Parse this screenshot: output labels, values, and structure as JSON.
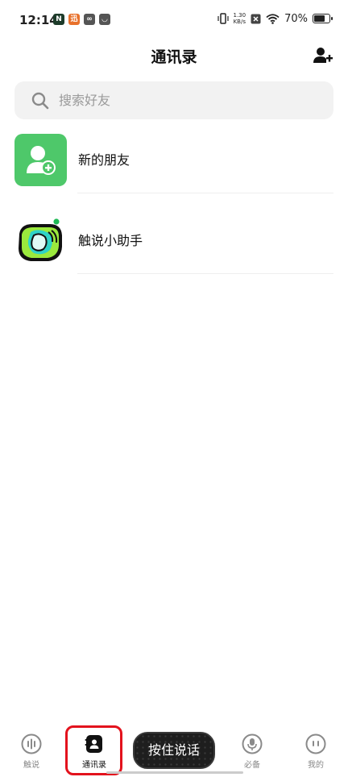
{
  "status_bar": {
    "time": "12:14",
    "net_speed_value": "1.30",
    "net_speed_unit": "KB/s",
    "battery": "70%",
    "battery_level": 0.7,
    "app_icons": [
      "notification-app-n-icon",
      "notification-app-orange-icon",
      "notification-app-link-icon",
      "notification-app-bag-icon"
    ]
  },
  "header": {
    "title": "通讯录",
    "add_friend_icon": "add-user-icon"
  },
  "search": {
    "placeholder": "搜索好友"
  },
  "contacts": [
    {
      "label": "新的朋友",
      "icon": "new-friend-icon",
      "color": "#4ec86a"
    },
    {
      "label": "触说小助手",
      "icon": "assistant-avatar",
      "status_dot": "#1db954"
    }
  ],
  "bottom_nav": {
    "items": [
      {
        "label": "触说",
        "icon": "voice-wave-icon"
      },
      {
        "label": "通讯录",
        "icon": "contacts-icon",
        "active": true
      },
      {
        "label": "必备",
        "icon": "microphone-icon"
      },
      {
        "label": "我的",
        "icon": "profile-face-icon"
      }
    ],
    "push_to_talk": "按住说话"
  },
  "colors": {
    "accent_green": "#4ec86a",
    "highlight_red": "#e3121d"
  }
}
